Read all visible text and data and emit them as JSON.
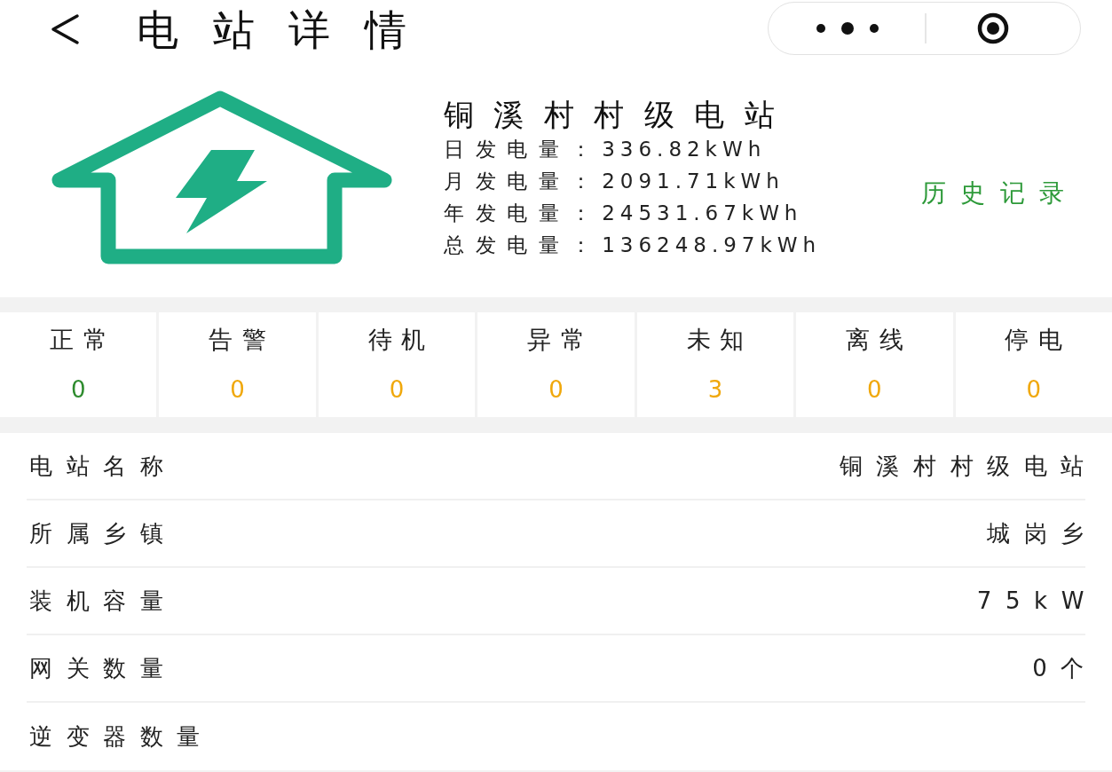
{
  "header": {
    "title": "电站详情"
  },
  "station": {
    "name": "铜溪村村级电站",
    "stats": [
      {
        "label": "日发电量：",
        "value": "336.82kWh"
      },
      {
        "label": "月发电量：",
        "value": "2091.71kWh"
      },
      {
        "label": "年发电量：",
        "value": "24531.67kWh"
      },
      {
        "label": "总发电量：",
        "value": "136248.97kWh"
      }
    ],
    "history_link": "历史记录"
  },
  "status_counts": [
    {
      "label": "正常",
      "count": "0",
      "color": "#2e8b2e"
    },
    {
      "label": "告警",
      "count": "0",
      "color": "#f0a80c"
    },
    {
      "label": "待机",
      "count": "0",
      "color": "#f0a80c"
    },
    {
      "label": "异常",
      "count": "0",
      "color": "#f0a80c"
    },
    {
      "label": "未知",
      "count": "3",
      "color": "#f0a80c"
    },
    {
      "label": "离线",
      "count": "0",
      "color": "#f0a80c"
    },
    {
      "label": "停电",
      "count": "0",
      "color": "#f0a80c"
    }
  ],
  "details": [
    {
      "label": "电站名称",
      "value": "铜溪村村级电站"
    },
    {
      "label": "所属乡镇",
      "value": "城岗乡"
    },
    {
      "label": "装机容量",
      "value": "75kW"
    },
    {
      "label": "网关数量",
      "value": "0个"
    },
    {
      "label": "逆变器数量"
    }
  ]
}
